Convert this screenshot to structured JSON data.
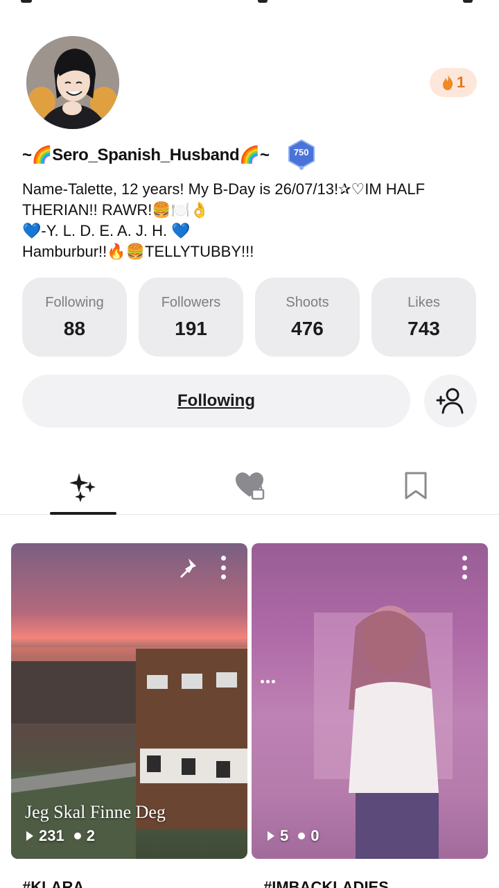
{
  "profile": {
    "username": "~🌈Sero_Spanish_Husband🌈~",
    "level": "750",
    "streak_count": "1",
    "bio_lines": [
      "Name-Talette, 12 years! My B-Day is 26/07/13!✰♡IM HALF",
      "THERIAN!! RAWR!🍔🍽️👌",
      "💙-Y. L. D. E. A. J. H. 💙",
      "Hamburbur!!🔥🍔TELLYTUBBY!!!"
    ]
  },
  "stats": [
    {
      "label": "Following",
      "value": "88"
    },
    {
      "label": "Followers",
      "value": "191"
    },
    {
      "label": "Shoots",
      "value": "476"
    },
    {
      "label": "Likes",
      "value": "743"
    }
  ],
  "actions": {
    "following_label": "Following"
  },
  "tabs": [
    {
      "icon": "sparkles-icon"
    },
    {
      "icon": "heart-lock-icon"
    },
    {
      "icon": "bookmark-icon"
    }
  ],
  "posts": [
    {
      "caption": "Jeg Skal Finne Deg",
      "views": "231",
      "comments": "2",
      "tag": "#KLARA"
    },
    {
      "caption": "",
      "views": "5",
      "comments": "0",
      "tag": "#IMBACKLADIES"
    }
  ],
  "colors": {
    "accent_orange": "#e8751a",
    "card_bg": "#ececef",
    "level_badge": "#4a72d8"
  }
}
